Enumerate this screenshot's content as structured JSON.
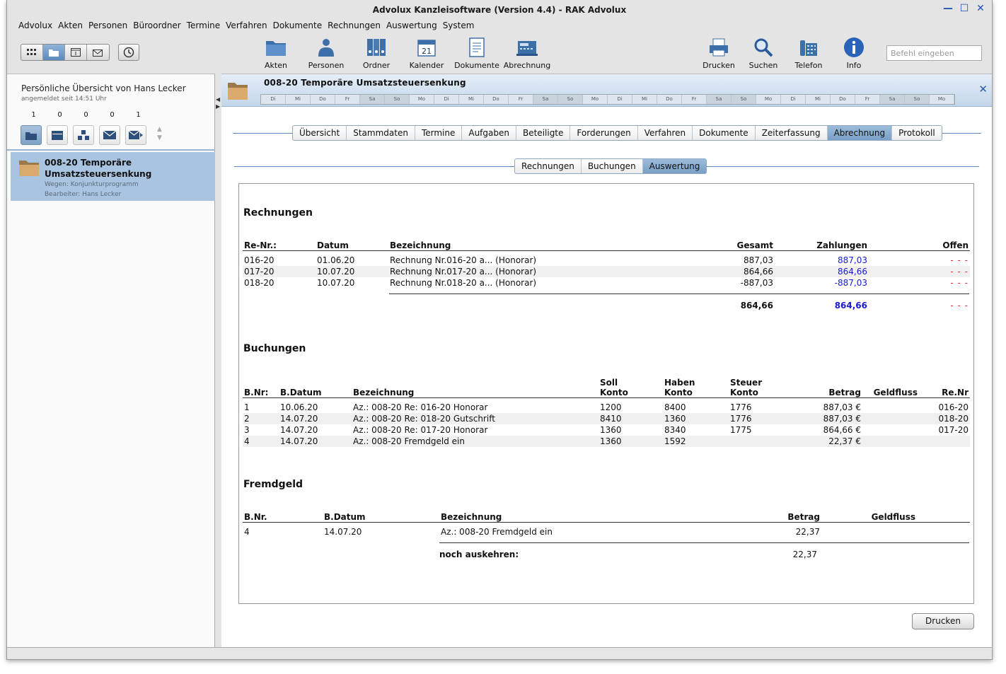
{
  "window": {
    "title": "Advolux Kanzleisoftware (Version 4.4) - RAK Advolux"
  },
  "menu": [
    "Advolux",
    "Akten",
    "Personen",
    "Büroordner",
    "Termine",
    "Verfahren",
    "Dokumente",
    "Rechnungen",
    "Auswertung",
    "System"
  ],
  "toolbar": {
    "left": [
      {
        "label": "Akten",
        "icon": "folder-icon"
      },
      {
        "label": "Personen",
        "icon": "person-icon"
      },
      {
        "label": "Ordner",
        "icon": "binder-icon"
      },
      {
        "label": "Kalender",
        "icon": "calendar-icon",
        "day": "21"
      },
      {
        "label": "Dokumente",
        "icon": "document-icon"
      },
      {
        "label": "Abrechnung",
        "icon": "cash-register-icon"
      }
    ],
    "right": [
      {
        "label": "Drucken",
        "icon": "printer-icon"
      },
      {
        "label": "Suchen",
        "icon": "magnifier-icon"
      },
      {
        "label": "Telefon",
        "icon": "phone-icon"
      },
      {
        "label": "Info",
        "icon": "info-icon"
      }
    ],
    "command_placeholder": "Befehl eingeben"
  },
  "sidebar": {
    "title": "Persönliche Übersicht von Hans Lecker",
    "subtitle": "angemeldet seit 14:51 Uhr",
    "counts": [
      "1",
      "0",
      "0",
      "0",
      "1"
    ],
    "item": {
      "title_line1": "008-20 Temporäre",
      "title_line2": "Umsatzsteuersenkung",
      "wegen": "Wegen: Konjunkturprogramm",
      "bearbeiter": "Bearbeiter: Hans Lecker"
    }
  },
  "akte": {
    "title": "008-20 Temporäre Umsatzsteuersenkung",
    "days": [
      "Di",
      "Mi",
      "Do",
      "Fr",
      "Sa",
      "So",
      "Mo",
      "Di",
      "Mi",
      "Do",
      "Fr",
      "Sa",
      "So",
      "Mo",
      "Di",
      "Mi",
      "Do",
      "Fr",
      "Sa",
      "So",
      "Mo",
      "Di",
      "Mi",
      "Do",
      "Fr",
      "Sa",
      "So",
      "Mo"
    ]
  },
  "tabs": [
    "Übersicht",
    "Stammdaten",
    "Termine",
    "Aufgaben",
    "Beteiligte",
    "Forderungen",
    "Verfahren",
    "Dokumente",
    "Zeiterfassung",
    "Abrechnung",
    "Protokoll"
  ],
  "active_tab": "Abrechnung",
  "subtabs": [
    "Rechnungen",
    "Buchungen",
    "Auswertung"
  ],
  "active_subtab": "Auswertung",
  "rechnungen": {
    "heading": "Rechnungen",
    "headers": [
      "Re-Nr.:",
      "Datum",
      "Bezeichnung",
      "Gesamt",
      "Zahlungen",
      "Offen"
    ],
    "rows": [
      [
        "016-20",
        "01.06.20",
        "Rechnung Nr.016-20 a... (Honorar)",
        "887,03",
        "887,03",
        "- - -"
      ],
      [
        "017-20",
        "10.07.20",
        "Rechnung Nr.017-20 a... (Honorar)",
        "864,66",
        "864,66",
        "- - -"
      ],
      [
        "018-20",
        "10.07.20",
        "Rechnung Nr.018-20 a... (Honorar)",
        "-887,03",
        "-887,03",
        "- - -"
      ]
    ],
    "total": {
      "gesamt": "864,66",
      "zahlungen": "864,66",
      "offen": "- - -"
    }
  },
  "buchungen": {
    "heading": "Buchungen",
    "headers": {
      "bnr": "B.Nr:",
      "bdatum": "B.Datum",
      "bez": "Bezeichnung",
      "soll1": "Soll",
      "soll2": "Konto",
      "haben1": "Haben",
      "haben2": "Konto",
      "steuer1": "Steuer",
      "steuer2": "Konto",
      "betrag": "Betrag",
      "geldfluss": "Geldfluss",
      "renr": "Re.Nr"
    },
    "rows": [
      [
        "1",
        "10.06.20",
        "Az.: 008-20 Re: 016-20 Honorar",
        "1200",
        "8400",
        "1776",
        "887,03 €",
        "",
        "016-20"
      ],
      [
        "2",
        "14.07.20",
        "Az.: 008-20 Re: 018-20 Gutschrift",
        "8410",
        "1360",
        "1776",
        "887,03 €",
        "",
        "018-20"
      ],
      [
        "3",
        "14.07.20",
        "Az.: 008-20 Re: 017-20 Honorar",
        "1360",
        "8340",
        "1775",
        "864,66 €",
        "",
        "017-20"
      ],
      [
        "4",
        "14.07.20",
        "Az.: 008-20 Fremdgeld ein",
        "1360",
        "1592",
        "",
        "22,37 €",
        "",
        ""
      ]
    ]
  },
  "fremdgeld": {
    "heading": "Fremdgeld",
    "headers": [
      "B.Nr.",
      "B.Datum",
      "Bezeichnung",
      "Betrag",
      "Geldfluss"
    ],
    "rows": [
      [
        "4",
        "14.07.20",
        "Az.: 008-20 Fremdgeld ein",
        "22,37",
        ""
      ]
    ],
    "rest_label": "noch auskehren:",
    "rest_value": "22,37"
  },
  "print_button": "Drucken"
}
